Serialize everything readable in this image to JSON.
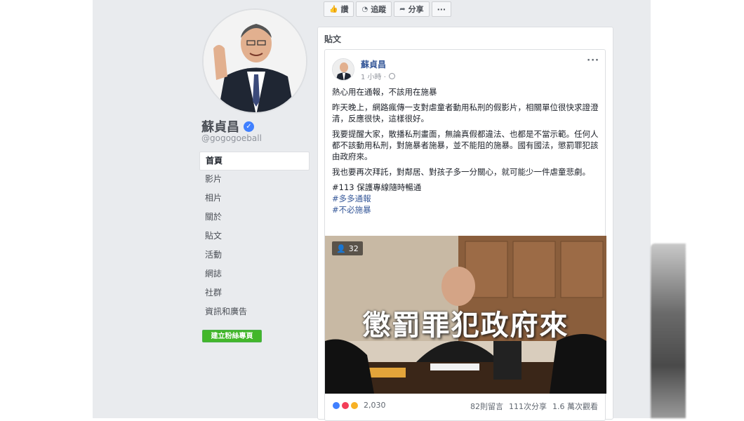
{
  "page": {
    "name": "蘇貞昌",
    "handle": "@gogogoeball"
  },
  "nav": {
    "items": [
      {
        "label": "首頁",
        "active": true
      },
      {
        "label": "影片"
      },
      {
        "label": "相片"
      },
      {
        "label": "關於"
      },
      {
        "label": "貼文"
      },
      {
        "label": "活動"
      },
      {
        "label": "網誌"
      },
      {
        "label": "社群"
      },
      {
        "label": "資訊和廣告"
      }
    ],
    "create_button": "建立粉絲專頁"
  },
  "actions": {
    "like": "讚",
    "follow": "追蹤",
    "share": "分享",
    "more": "···"
  },
  "posts": {
    "title": "貼文",
    "post": {
      "author": "蘇貞昌",
      "time": "1 小時 ·",
      "paragraphs": [
        "熱心用在通報，不該用在施暴",
        "昨天晚上，網路瘋傳一支對虐童者動用私刑的假影片，相關單位很快求證澄清，反應很快，這樣很好。",
        "我要提醒大家，散播私刑畫面，無論真假都違法、也都是不當示範。任何人都不該動用私刑，對施暴者施暴，並不能阻的施暴。國有國法，懲罰罪犯該由政府來。",
        "我也要再次拜託，對鄰居、對孩子多一分關心，就可能少一件虐童悲劇。"
      ],
      "line1": "#113 保護專線隨時暢通",
      "hashtags": [
        "#多多通報",
        "#不必施暴"
      ],
      "photo_count": "32",
      "photo_overlay": "懲罰罪犯政府來",
      "reactions_count": "2,030",
      "comments": "82則留言",
      "shares": "111次分享",
      "views": "1.6 萬次觀看"
    }
  },
  "colors": {
    "brand_link": "#365899",
    "create_button": "#42b72a",
    "verified": "#4080ff",
    "background": "#e9ebee"
  }
}
